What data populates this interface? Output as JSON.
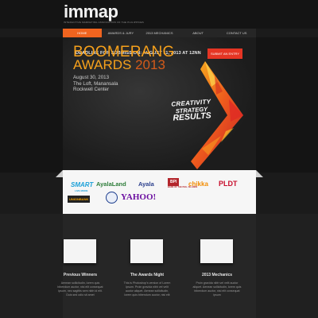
{
  "header": {
    "logo": "immap",
    "tagline": "INTERACTIVE MARKETING ASSOCIATION OF THE PHILIPPINES"
  },
  "nav": {
    "items": [
      {
        "label": "HOME",
        "active": true
      },
      {
        "label": "AWARDS & JURY",
        "active": false
      },
      {
        "label": "2013 MECHANICS",
        "active": false
      },
      {
        "label": "ABOUT",
        "active": false
      },
      {
        "label": "CONTACT US",
        "active": false
      }
    ]
  },
  "hero": {
    "deadline": "DEADLINE FOR SUBMISSION: AUGUST 11, 2013 AT 12NN",
    "submit_label": "SUBMIT AN ENTRY",
    "title_line1": "BOOMERANG",
    "title_line2": "AWARDS",
    "title_year": "2013",
    "event_date": "August 30, 2013",
    "event_venue": "The Loft, Manansala",
    "event_place": "Rockwell Center",
    "slogan1": "CREATIVITY",
    "slogan2": "STRATEGY",
    "slogan3": "RESULTS",
    "colors": {
      "orange": "#f7a11b",
      "red": "#e53524"
    }
  },
  "sponsors": {
    "smart": "SMART",
    "smart_sub": "LIVE MORE",
    "ayalaland": "AyalaLand",
    "ayala": "Ayala",
    "bpi": "BPI",
    "bpi_sub": "BANK OF THE PHIL. ISLANDS",
    "chikka": "chikka",
    "pldt": "PLDT",
    "unionbank": "UNIONBANK",
    "yahoo": "YAHOO!"
  },
  "sections": [
    {
      "title": "Previous Winners",
      "desc": "Aenean sollicitudin, lorem quis bibendum auctor, nisi elit consequat ipsum, nec sagittis sem nibh id elit. Duis sed odio sit amet"
    },
    {
      "title": "The Awards Night",
      "desc": "This is Photoshop's version of Lorem Ipsum. Proin gravida nibh vel velit auctor aliquet. Aenean sollicitudin, lorem quis bibendum auctor, nisi elit"
    },
    {
      "title": "2013 Mechanics",
      "desc": "Proin gravida nibh vel velit auctor aliquet. Aenean sollicitudin, lorem quis bibendum auctor, nisi elit consequat ipsum"
    }
  ]
}
